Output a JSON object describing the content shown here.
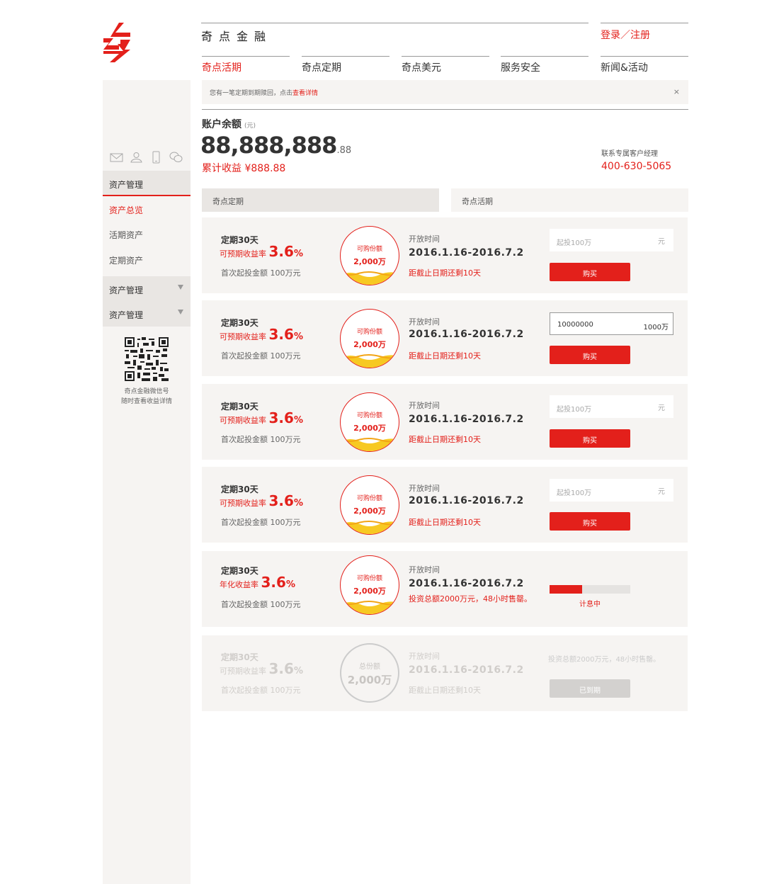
{
  "colors": {
    "accent": "#e3201b",
    "panel": "#f6f4f2",
    "panel_dark": "#e9e6e3",
    "wave": "#f7c922"
  },
  "header": {
    "brand": "奇点金融",
    "login": "登录／注册",
    "nav": [
      {
        "label": "奇点活期",
        "active": true
      },
      {
        "label": "奇点定期"
      },
      {
        "label": "奇点美元"
      },
      {
        "label": "服务安全"
      },
      {
        "label": "新闻&活动"
      }
    ]
  },
  "sidebar": {
    "icons": [
      "mail-icon",
      "user-icon",
      "phone-icon",
      "wechat-icon"
    ],
    "group1": "资产管理",
    "links": [
      "资产总览",
      "活期资产",
      "定期资产"
    ],
    "group2": "资产管理",
    "group3": "资产管理",
    "qr_caption_1": "奇点金融微信号",
    "qr_caption_2": "随时查看收益详情"
  },
  "notice": {
    "text": "您有一笔定期到期赎回，点击",
    "link": "查看详情",
    "close": "×"
  },
  "account": {
    "label": "账户余额",
    "unit": "(元)",
    "balance_int": "88,888,888",
    "balance_dec": ".88",
    "earnings": "累计收益 ¥888.88",
    "manager_label": "联系专属客户经理",
    "manager_phone": "400-630-5065"
  },
  "tabs": [
    "奇点定期",
    "奇点活期"
  ],
  "products": [
    {
      "title": "定期30天",
      "rate_label": "可预期收益率",
      "rate": "3.6",
      "pct": "%",
      "min": "首次起投金额 100万元",
      "circle_label": "可购份额",
      "circle_value": "2,000万",
      "open_label": "开放时间",
      "dates": "2016.1.16-2016.7.2",
      "remain": "距截止日期还剩10天",
      "input_placeholder": "起投100万",
      "input_suffix": "元",
      "buy": "购买"
    },
    {
      "title": "定期30天",
      "rate_label": "可预期收益率",
      "rate": "3.6",
      "pct": "%",
      "min": "首次起投金额 100万元",
      "circle_label": "可购份额",
      "circle_value": "2,000万",
      "open_label": "开放时间",
      "dates": "2016.1.16-2016.7.2",
      "remain": "距截止日期还剩10天",
      "input_value": "10000000",
      "input_suffix": "1000万",
      "buy": "购买"
    },
    {
      "title": "定期30天",
      "rate_label": "可预期收益率",
      "rate": "3.6",
      "pct": "%",
      "min": "首次起投金额 100万元",
      "circle_label": "可购份额",
      "circle_value": "2,000万",
      "open_label": "开放时间",
      "dates": "2016.1.16-2016.7.2",
      "remain": "距截止日期还剩10天",
      "input_placeholder": "起投100万",
      "input_suffix": "元",
      "buy": "购买"
    },
    {
      "title": "定期30天",
      "rate_label": "可预期收益率",
      "rate": "3.6",
      "pct": "%",
      "min": "首次起投金额 100万元",
      "circle_label": "可购份额",
      "circle_value": "2,000万",
      "open_label": "开放时间",
      "dates": "2016.1.16-2016.7.2",
      "remain": "距截止日期还剩10天",
      "input_placeholder": "起投100万",
      "input_suffix": "元",
      "buy": "购买"
    },
    {
      "title": "定期30天",
      "rate_label": "年化收益率",
      "rate": "3.6",
      "pct": "%",
      "min": "首次起投金额 100万元",
      "circle_label": "可购份额",
      "circle_value": "2,000万",
      "open_label": "开放时间",
      "dates": "2016.1.16-2016.7.2",
      "remain": "投资总额2000万元，48小时售罄。",
      "progress": 0.4,
      "progress_label": "计息中"
    },
    {
      "title": "定期30天",
      "rate_label": "可预期收益率",
      "rate": "3.6",
      "pct": "%",
      "min": "首次起投金额 100万元",
      "circle_label": "总份额",
      "circle_value": "2,000万",
      "open_label": "开放时间",
      "dates": "2016.1.16-2016.7.2",
      "remain": "距截止日期还剩10天",
      "total_note": "投资总额2000万元，48小时售罄。",
      "buy": "已到期"
    }
  ]
}
